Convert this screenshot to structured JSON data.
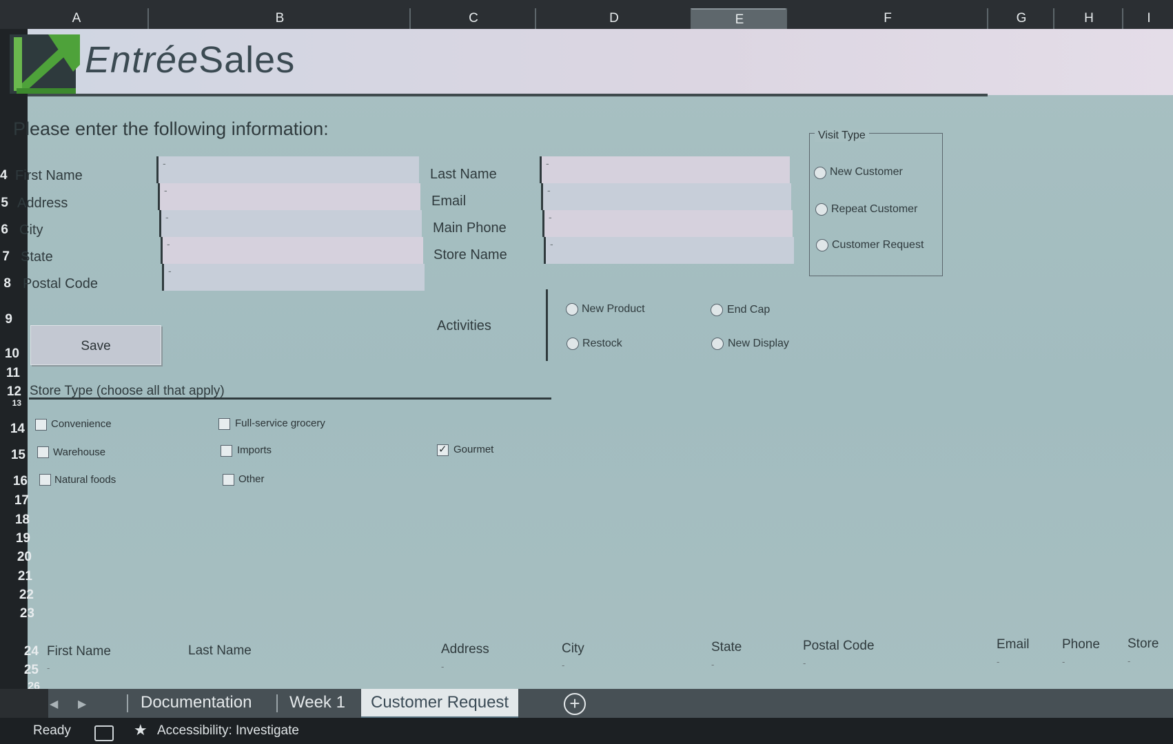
{
  "columns": [
    "A",
    "B",
    "C",
    "D",
    "E",
    "F",
    "G",
    "H",
    "I"
  ],
  "rows": [
    "4",
    "5",
    "6",
    "7",
    "8",
    "9",
    "10",
    "11",
    "12",
    "13",
    "14",
    "15",
    "16",
    "17",
    "18",
    "19",
    "20",
    "21",
    "22",
    "23",
    "24",
    "25",
    "26"
  ],
  "brand": {
    "part1": "Entrée",
    "part2": "Sales"
  },
  "form": {
    "heading": "Please enter the following information:",
    "left_labels": [
      "First Name",
      "Address",
      "City",
      "State",
      "Postal Code"
    ],
    "right_labels": [
      "Last Name",
      "Email",
      "Main Phone",
      "Store Name"
    ],
    "field_placeholder": "-",
    "save_label": "Save",
    "activities_label": "Activities"
  },
  "visit_type": {
    "title": "Visit Type",
    "options": [
      "New Customer",
      "Repeat Customer",
      "Customer Request"
    ]
  },
  "activities": [
    "New Product",
    "End Cap",
    "Restock",
    "New Display"
  ],
  "store_type": {
    "title": "Store Type (choose all that apply)",
    "options": [
      {
        "label": "Convenience",
        "checked": false
      },
      {
        "label": "Full-service grocery",
        "checked": false
      },
      {
        "label": "Warehouse",
        "checked": false
      },
      {
        "label": "Imports",
        "checked": false
      },
      {
        "label": "Gourmet",
        "checked": true
      },
      {
        "label": "Natural foods",
        "checked": false
      },
      {
        "label": "Other",
        "checked": false
      }
    ]
  },
  "table": {
    "headers": [
      "First Name",
      "Last Name",
      "Address",
      "City",
      "State",
      "Postal Code",
      "Email",
      "Phone",
      "Store"
    ],
    "empty_value": "-"
  },
  "tabs": [
    "Documentation",
    "Week 1",
    "Customer Request"
  ],
  "active_tab": "Customer Request",
  "status": {
    "ready": "Ready",
    "accessibility": "Accessibility: Investigate"
  },
  "colors": {
    "sheet_bg": "#a8c0c2",
    "accent_green": "#3d8a2e",
    "active_tab": "#e3e8ea"
  }
}
